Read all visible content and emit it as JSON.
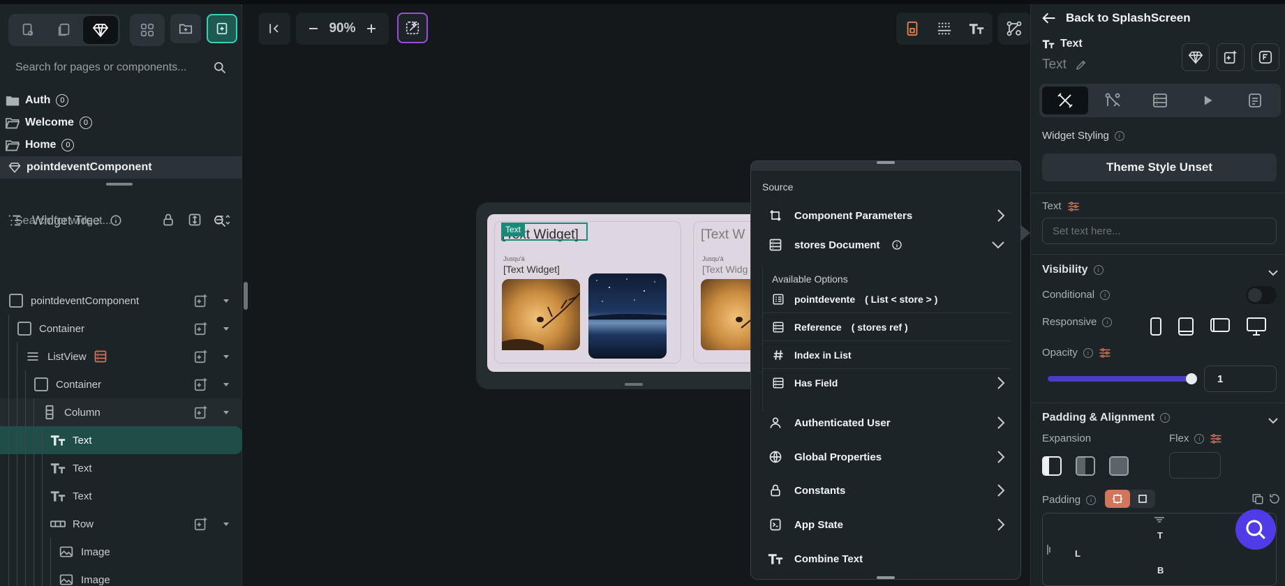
{
  "left_panel": {
    "page_search_placeholder": "Search for pages or components...",
    "pages": [
      {
        "name": "Auth",
        "count": "0"
      },
      {
        "name": "Welcome",
        "count": "0"
      },
      {
        "name": "Home",
        "count": "0"
      }
    ],
    "component": "pointdeventComponent",
    "widget_tree_title": "Widget Tree",
    "widget_search_placeholder": "Search for widget...",
    "tree": [
      {
        "label": "pointdeventComponent"
      },
      {
        "label": "Container"
      },
      {
        "label": "ListView"
      },
      {
        "label": "Container"
      },
      {
        "label": "Column"
      },
      {
        "label": "Text"
      },
      {
        "label": "Text"
      },
      {
        "label": "Text"
      },
      {
        "label": "Row"
      },
      {
        "label": "Image"
      },
      {
        "label": "Image"
      }
    ]
  },
  "canvas": {
    "zoom": "90%",
    "selection_tag": "Text",
    "cards": [
      {
        "heading": "[Text Widget]",
        "jusqua": "Jusqu'à",
        "subtext": "[Text Widget]"
      },
      {
        "heading": "[Text W",
        "jusqua": "Jusqu'à",
        "subtext": "[Text Widg"
      }
    ]
  },
  "source_popup": {
    "title": "Source",
    "items": [
      {
        "label": "Component Parameters",
        "icon": "parameters-icon"
      },
      {
        "label": "stores Document",
        "icon": "document-icon"
      }
    ],
    "available_options_label": "Available Options",
    "options": [
      {
        "label": "pointdevente",
        "type": "( List < store > )"
      },
      {
        "label": "Reference",
        "type": "( stores ref )"
      },
      {
        "label": "Index in List",
        "type": ""
      },
      {
        "label": "Has Field",
        "type": ""
      }
    ],
    "more_items": [
      {
        "label": "Authenticated User"
      },
      {
        "label": "Global Properties"
      },
      {
        "label": "Constants"
      },
      {
        "label": "App State"
      },
      {
        "label": "Combine Text"
      }
    ]
  },
  "right_panel": {
    "back_label": "Back to SplashScreen",
    "widget_type": "Text",
    "widget_name": "Text",
    "widget_styling": "Widget Styling",
    "theme_style": "Theme Style Unset",
    "text_label": "Text",
    "text_placeholder": "Set text here...",
    "visibility": "Visibility",
    "conditional": "Conditional",
    "responsive": "Responsive",
    "opacity": "Opacity",
    "opacity_value": "1",
    "padding_alignment": "Padding & Alignment",
    "expansion": "Expansion",
    "flex": "Flex",
    "padding": "Padding",
    "pad_top": "T",
    "pad_left": "L",
    "pad_bottom": "B"
  },
  "colors": {
    "accent": "#39d2b4",
    "selection": "#1a8a78",
    "brand_purple": "#4f3ce6",
    "slider": "#4b3cc9",
    "padding_active": "#d2755a"
  }
}
